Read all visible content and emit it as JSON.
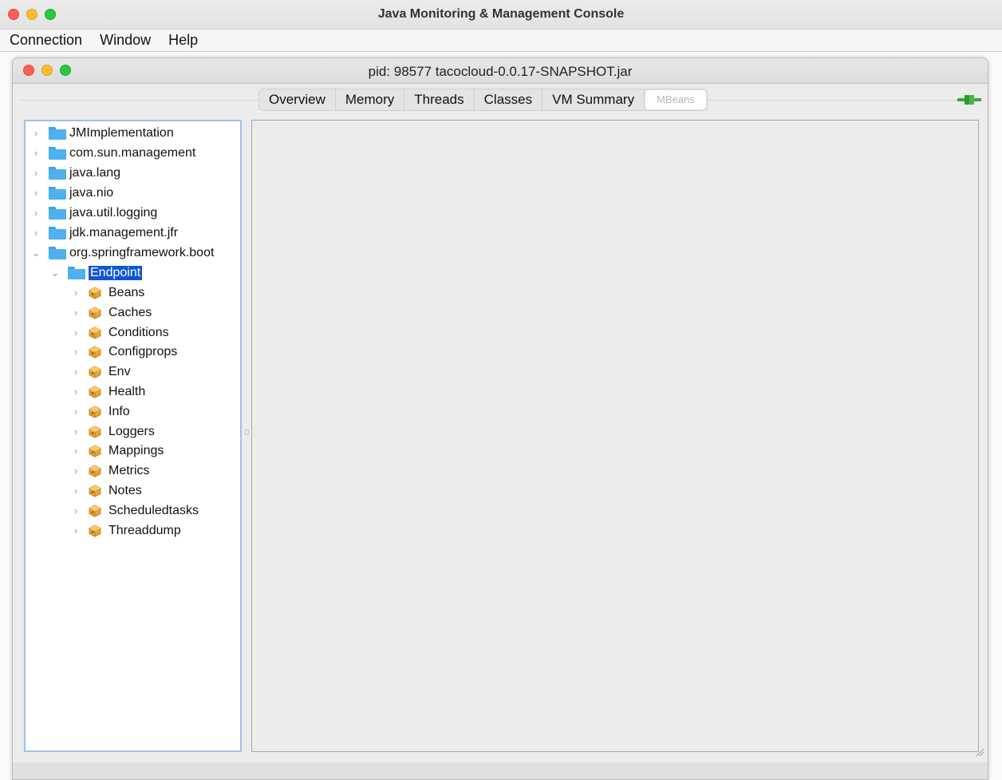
{
  "app": {
    "title": "Java Monitoring & Management Console",
    "menu": [
      "Connection",
      "Window",
      "Help"
    ]
  },
  "frame": {
    "title": "pid: 98577 tacocloud-0.0.17-SNAPSHOT.jar"
  },
  "tabs": [
    {
      "label": "Overview",
      "active": false
    },
    {
      "label": "Memory",
      "active": false
    },
    {
      "label": "Threads",
      "active": false
    },
    {
      "label": "Classes",
      "active": false
    },
    {
      "label": "VM Summary",
      "active": false
    },
    {
      "label": "MBeans",
      "active": true
    }
  ],
  "tree": {
    "domains": [
      {
        "label": "JMImplementation",
        "expanded": false
      },
      {
        "label": "com.sun.management",
        "expanded": false
      },
      {
        "label": "java.lang",
        "expanded": false
      },
      {
        "label": "java.nio",
        "expanded": false
      },
      {
        "label": "java.util.logging",
        "expanded": false
      },
      {
        "label": "jdk.management.jfr",
        "expanded": false
      },
      {
        "label": "org.springframework.boot",
        "expanded": true
      }
    ],
    "selected_folder": {
      "label": "Endpoint",
      "expanded": true
    },
    "beans": [
      "Beans",
      "Caches",
      "Conditions",
      "Configprops",
      "Env",
      "Health",
      "Info",
      "Loggers",
      "Mappings",
      "Metrics",
      "Notes",
      "Scheduledtasks",
      "Threaddump"
    ]
  },
  "colors": {
    "selection": "#1155d6",
    "folder": "#4eb0ee",
    "tree_border": "#9bc3ea",
    "connect_icon": "#3aa83a"
  },
  "icons": {
    "domain": "folder-icon",
    "bean": "mbean-icon",
    "collapsed": "chevron-right-icon",
    "expanded": "chevron-down-icon",
    "connection": "connected-plug-icon"
  }
}
